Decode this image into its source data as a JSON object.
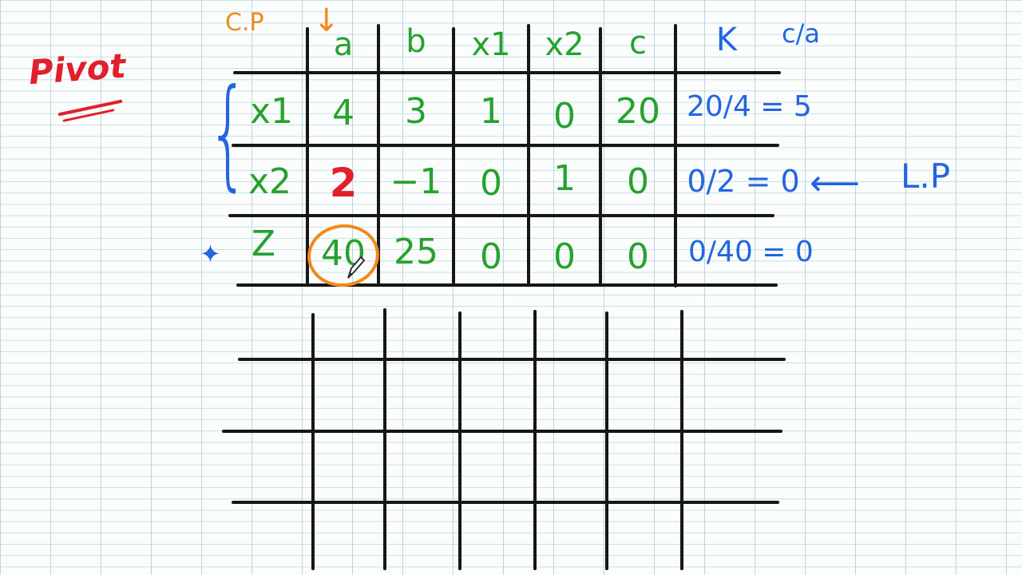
{
  "page": {
    "title": "Pivot",
    "pivot_column_label": "C.P",
    "pivot_row_label": "L.P",
    "arrow_down": "↓",
    "arrow_left": "⟵",
    "brace": "{",
    "star_marker": "✦"
  },
  "table": {
    "headers": [
      "a",
      "b",
      "x1",
      "x2",
      "c",
      "K",
      "c/a"
    ],
    "rows": [
      {
        "label": "x1",
        "cells": [
          "4",
          "3",
          "1",
          "0",
          "20"
        ],
        "ratio": "20/4 = 5"
      },
      {
        "label": "x2",
        "cells": [
          "2",
          "−1",
          "0",
          "1",
          "0"
        ],
        "ratio": "0/2 = 0"
      },
      {
        "label": "Z",
        "cells": [
          "40",
          "25",
          "0",
          "0",
          "0"
        ],
        "ratio": "0/40 = 0"
      }
    ]
  },
  "colors": {
    "ink": "#161616",
    "values": "#26a22e",
    "annotations": "#2266e0",
    "pivot_column": "#f08a1a",
    "title": "#e2202a",
    "pivot_element": "#e2202a"
  }
}
